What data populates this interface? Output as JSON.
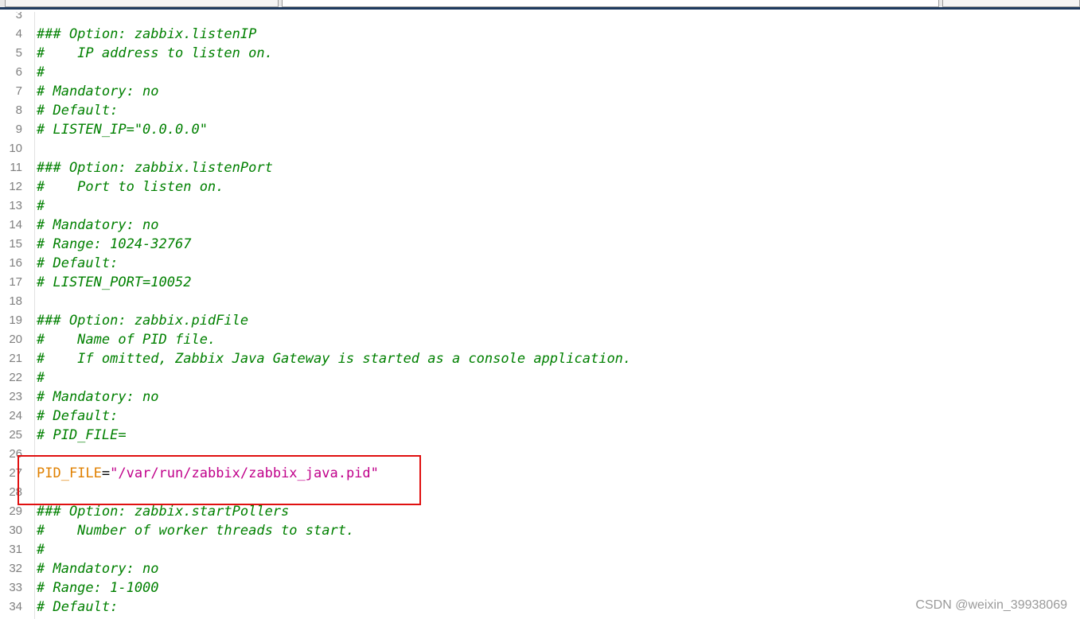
{
  "editor": {
    "lines": [
      {
        "n": "3",
        "text": ""
      },
      {
        "n": "4",
        "text": "### Option: zabbix.listenIP"
      },
      {
        "n": "5",
        "text": "#    IP address to listen on."
      },
      {
        "n": "6",
        "text": "#"
      },
      {
        "n": "7",
        "text": "# Mandatory: no"
      },
      {
        "n": "8",
        "text": "# Default:"
      },
      {
        "n": "9",
        "text": "# LISTEN_IP=\"0.0.0.0\""
      },
      {
        "n": "10",
        "text": ""
      },
      {
        "n": "11",
        "text": "### Option: zabbix.listenPort"
      },
      {
        "n": "12",
        "text": "#    Port to listen on."
      },
      {
        "n": "13",
        "text": "#"
      },
      {
        "n": "14",
        "text": "# Mandatory: no"
      },
      {
        "n": "15",
        "text": "# Range: 1024-32767"
      },
      {
        "n": "16",
        "text": "# Default:"
      },
      {
        "n": "17",
        "text": "# LISTEN_PORT=10052"
      },
      {
        "n": "18",
        "text": ""
      },
      {
        "n": "19",
        "text": "### Option: zabbix.pidFile"
      },
      {
        "n": "20",
        "text": "#    Name of PID file."
      },
      {
        "n": "21",
        "text": "#    If omitted, Zabbix Java Gateway is started as a console application."
      },
      {
        "n": "22",
        "text": "#"
      },
      {
        "n": "23",
        "text": "# Mandatory: no"
      },
      {
        "n": "24",
        "text": "# Default:"
      },
      {
        "n": "25",
        "text": "# PID_FILE="
      },
      {
        "n": "26",
        "text": ""
      },
      {
        "n": "27",
        "key": "PID_FILE",
        "op": "=",
        "value": "\"/var/run/zabbix/zabbix_java.pid\""
      },
      {
        "n": "28",
        "text": ""
      },
      {
        "n": "29",
        "text": "### Option: zabbix.startPollers"
      },
      {
        "n": "30",
        "text": "#    Number of worker threads to start."
      },
      {
        "n": "31",
        "text": "#"
      },
      {
        "n": "32",
        "text": "# Mandatory: no"
      },
      {
        "n": "33",
        "text": "# Range: 1-1000"
      },
      {
        "n": "34",
        "text": "# Default:"
      }
    ]
  },
  "watermark": "CSDN @weixin_39938069",
  "colors": {
    "comment": "#008000",
    "key": "#e08000",
    "string": "#c0008a",
    "highlight_border": "#e01010",
    "line_number": "#808080"
  }
}
